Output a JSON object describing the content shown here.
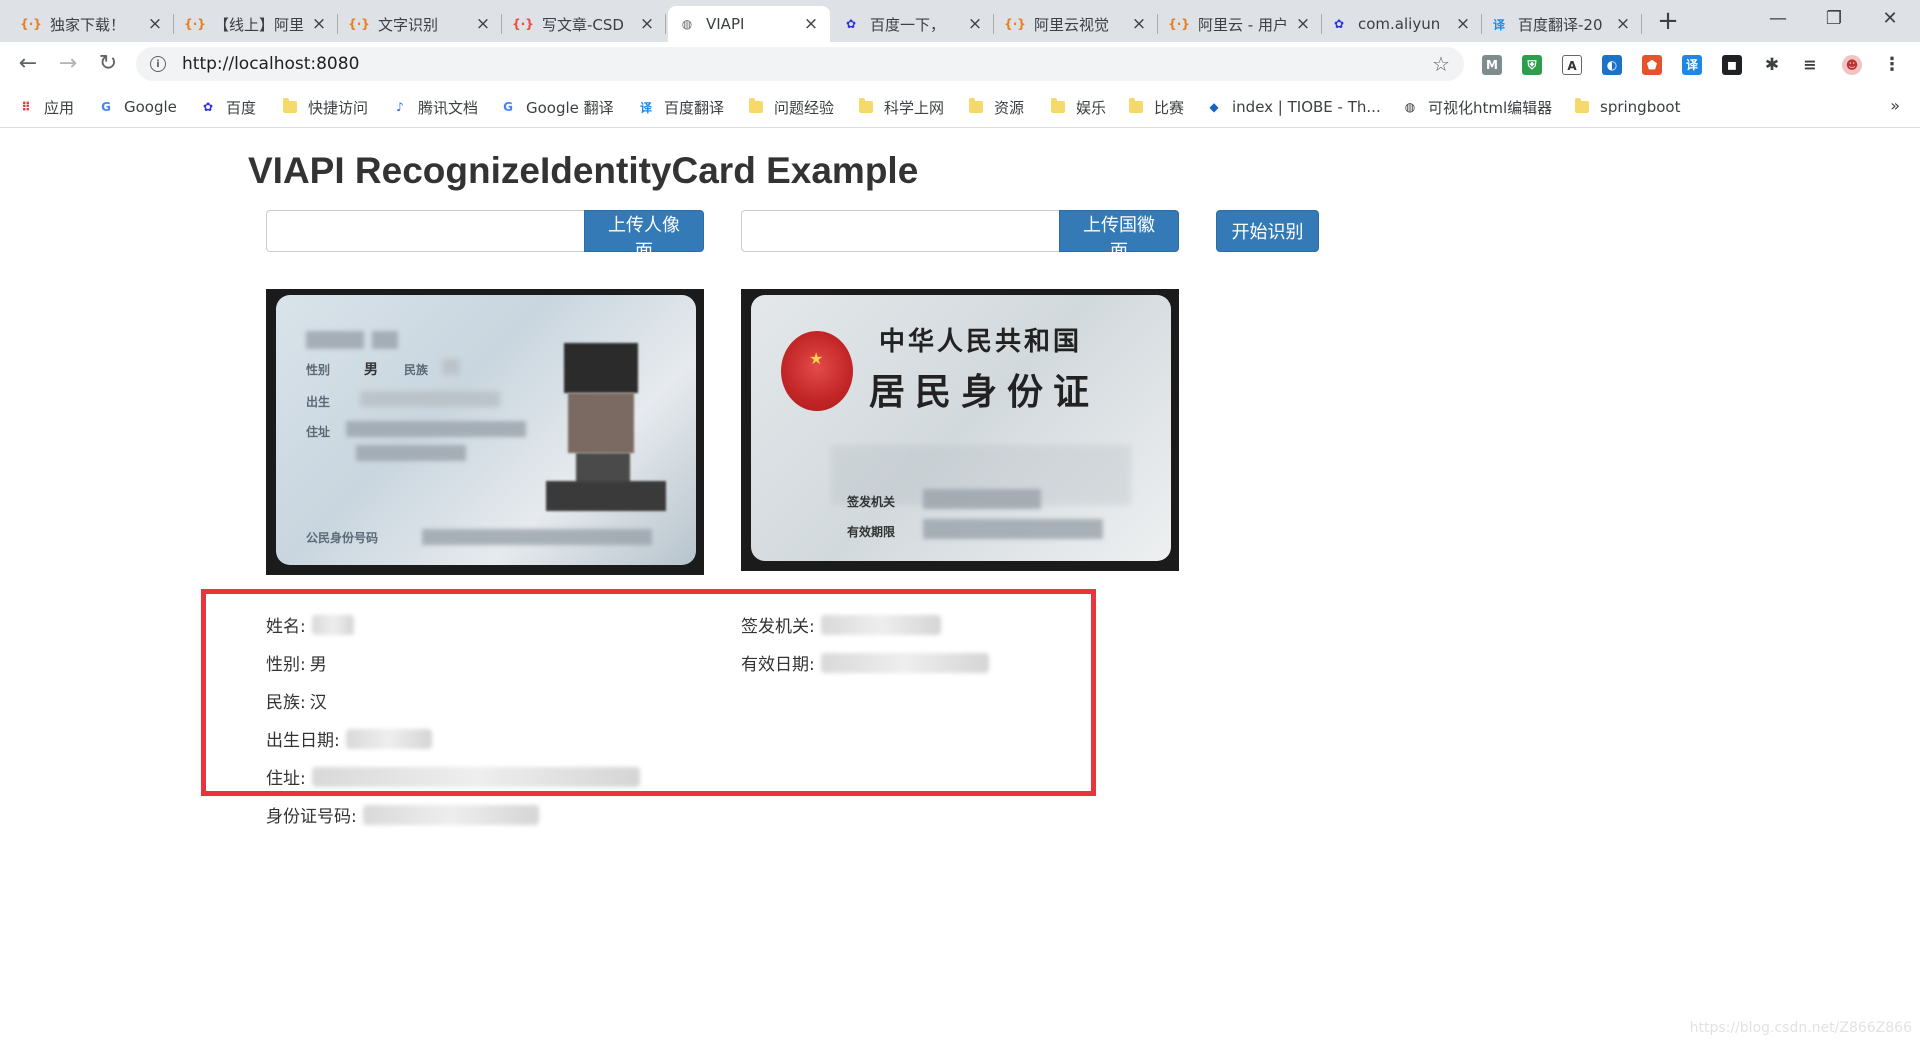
{
  "browser": {
    "tabs": [
      {
        "title": "独家下载！",
        "favicon": "csdn-icon",
        "color": "#e67e22"
      },
      {
        "title": "【线上】阿里",
        "favicon": "aliyun-icon",
        "color": "#e67e22"
      },
      {
        "title": "文字识别",
        "favicon": "aliyun-icon",
        "color": "#e67e22"
      },
      {
        "title": "写文章-CSD",
        "favicon": "csdn-icon",
        "color": "#e74c3c"
      },
      {
        "title": "VIAPI",
        "favicon": "globe-icon",
        "color": "#5f6368"
      },
      {
        "title": "百度一下，",
        "favicon": "baidu-icon",
        "color": "#2932e1"
      },
      {
        "title": "阿里云视觉",
        "favicon": "aliyun-icon",
        "color": "#e67e22"
      },
      {
        "title": "阿里云 - 用户",
        "favicon": "aliyun-icon",
        "color": "#e67e22"
      },
      {
        "title": "com.aliyun",
        "favicon": "baidu-icon",
        "color": "#2932e1"
      },
      {
        "title": "百度翻译-20",
        "favicon": "translate-icon",
        "color": "#1e88e5"
      }
    ],
    "active_tab": 4,
    "url": "http://localhost:8080",
    "bookmarks": [
      {
        "label": "应用",
        "icon": "apps-grid-icon"
      },
      {
        "label": "Google",
        "icon": "google-icon"
      },
      {
        "label": "百度",
        "icon": "baidu-icon"
      },
      {
        "label": "快捷访问",
        "icon": "folder-icon"
      },
      {
        "label": "腾讯文档",
        "icon": "tencent-docs-icon"
      },
      {
        "label": "Google 翻译",
        "icon": "google-translate-icon"
      },
      {
        "label": "百度翻译",
        "icon": "translate-icon"
      },
      {
        "label": "问题经验",
        "icon": "folder-icon"
      },
      {
        "label": "科学上网",
        "icon": "folder-icon"
      },
      {
        "label": "资源",
        "icon": "folder-icon"
      },
      {
        "label": "娱乐",
        "icon": "folder-icon"
      },
      {
        "label": "比赛",
        "icon": "folder-icon"
      },
      {
        "label": "index | TIOBE - Th...",
        "icon": "tiobe-icon"
      },
      {
        "label": "可视化html编辑器",
        "icon": "globe-icon"
      },
      {
        "label": "springboot",
        "icon": "folder-icon"
      }
    ],
    "bookmarks_more": "»"
  },
  "page": {
    "title": "VIAPI RecognizeIdentityCard Example",
    "upload_face_label": "上传人像面",
    "upload_emblem_label": "上传国徽面",
    "recognize_label": "开始识别",
    "back_card": {
      "line1": "中华人民共和国",
      "line2": "居民身份证",
      "issuer_label": "签发机关",
      "valid_label": "有效期限"
    },
    "front_card": {
      "gender_label": "性别",
      "gender_value": "男",
      "ethnic_label": "民族",
      "birth_label": "出生",
      "address_label": "住址",
      "id_label": "公民身份号码"
    },
    "results": {
      "name_label": "姓名:",
      "gender_label": "性别:",
      "gender_value": "男",
      "ethnicity_label": "民族:",
      "ethnicity_value": "汉",
      "birth_label": "出生日期:",
      "address_label": "住址:",
      "id_label": "身份证号码:",
      "issuer_label": "签发机关:",
      "validity_label": "有效日期:"
    }
  },
  "watermark": "https://blog.csdn.net/Z866Z866"
}
